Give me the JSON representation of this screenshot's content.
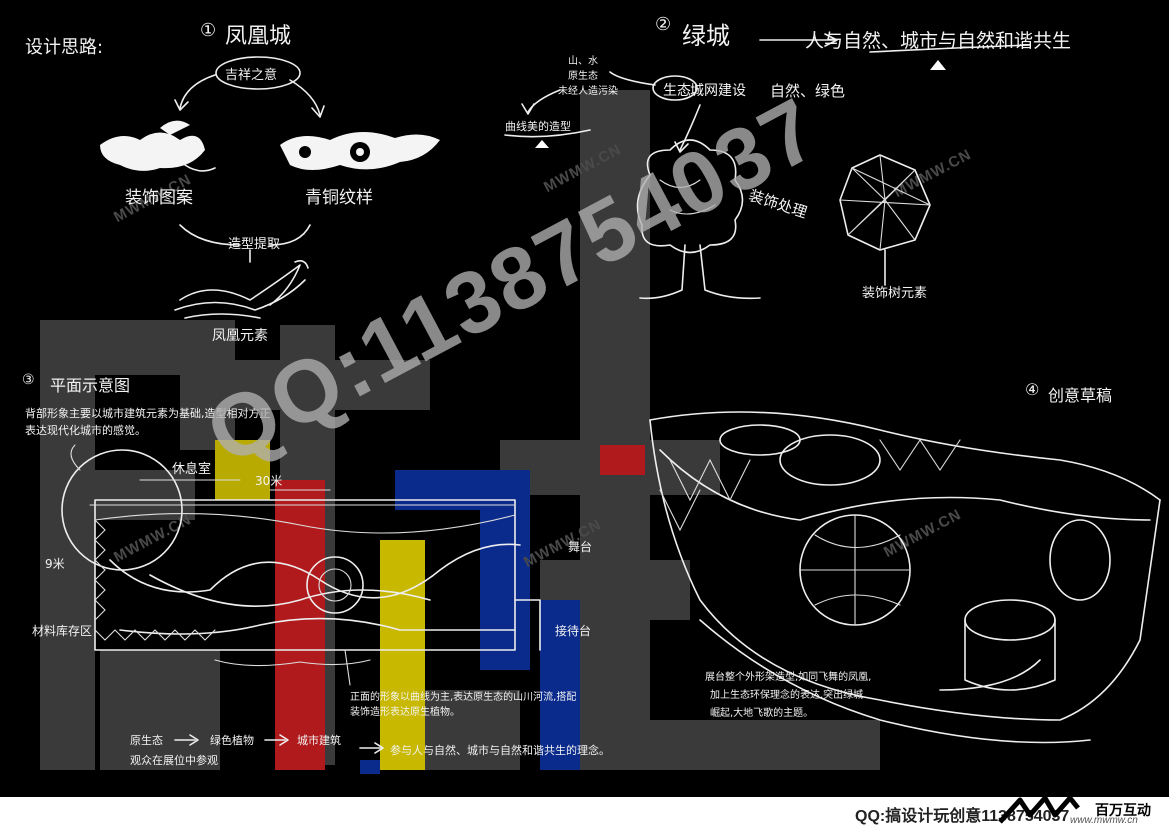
{
  "watermark": {
    "qq_number": "QQ:1138754037",
    "site": "MWMW.CN",
    "colors": {
      "gray_block": "#3a3a3a",
      "red": "#c0181c",
      "yellow": "#d4c200",
      "blue": "#0a2a8c"
    }
  },
  "section1": {
    "heading": "设计思路:",
    "num": "①",
    "title": "凤凰城",
    "oval_label": "吉祥之意",
    "left_label": "装饰图案",
    "right_label": "青铜纹样",
    "middle_label": "造型提取",
    "bottom_label": "凤凰元素"
  },
  "section2": {
    "num": "②",
    "title": "绿城",
    "slogan": "人与自然、城市与自然和谐共生",
    "left_note_1": "山、水",
    "left_note_2": "原生态",
    "left_note_3": "未经人造污染",
    "eco_label": "生态",
    "eco_rest": "城网建设",
    "nature_green": "自然、绿色",
    "curve_label": "曲线美的造型",
    "tree_label": "装饰处理",
    "decor_tree_label": "装饰树元素"
  },
  "section3": {
    "num": "③",
    "title": "平面示意图",
    "note_1": "背部形象主要以城市建筑元素为基础,造型相对方正",
    "note_2": "表达现代化城市的感觉。",
    "label_lounge": "休息室",
    "label_width": "30米",
    "label_depth": "9米",
    "label_materials": "材料库存区",
    "label_stage": "舞台",
    "label_reception": "接待台",
    "note_curve_1": "正面的形象以曲线为主,表达原生态的山川河流,搭配",
    "note_curve_2": "装饰造形表达原生植物。",
    "flow_1": "原生态",
    "flow_2": "绿色植物",
    "flow_3": "城市建筑",
    "flow_4": "观众在展位中参观",
    "flow_5": "参与人与自然、城市与自然和谐共生的理念。"
  },
  "section4": {
    "num": "④",
    "title": "创意草稿",
    "note_1": "展台整个外形架造型,如同飞舞的凤凰,",
    "note_2": "加上生态环保理念的表达,突出绿城",
    "note_3": "崛起,大地飞歌的主题。"
  },
  "footer": {
    "qq_text": "QQ:搞设计玩创意1138754037",
    "brand": "百万互动",
    "url": "www.mwmw.cn"
  }
}
